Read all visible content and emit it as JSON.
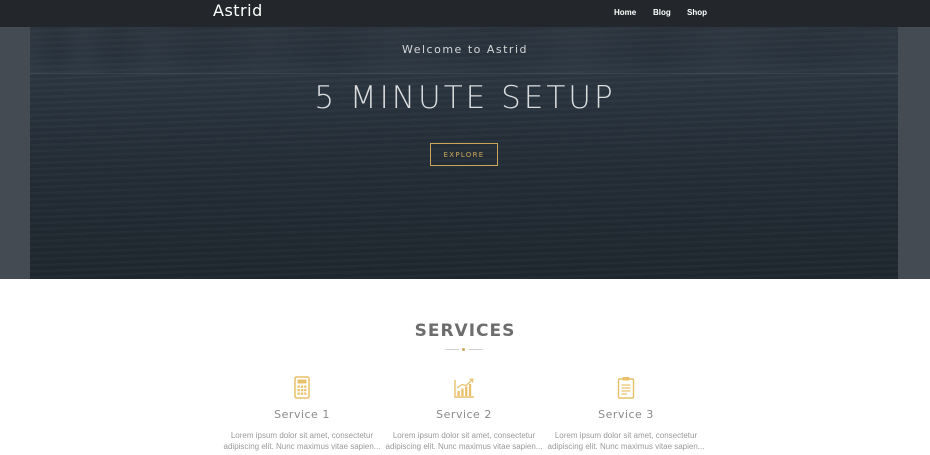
{
  "header": {
    "logo": "Astrid",
    "nav": [
      {
        "label": "Home"
      },
      {
        "label": "Blog"
      },
      {
        "label": "Shop"
      }
    ]
  },
  "hero": {
    "subtitle": "Welcome to Astrid",
    "title": "5 MINUTE SETUP",
    "button_label": "EXPLORE"
  },
  "services": {
    "title": "SERVICES",
    "accent_color": "#c9a65a",
    "items": [
      {
        "icon": "calculator-icon",
        "name": "Service 1",
        "desc_line1": "Lorem ipsum dolor sit amet, consectetur",
        "desc_line2": "adipiscing elit. Nunc maximus vitae sapien..."
      },
      {
        "icon": "chart-icon",
        "name": "Service 2",
        "desc_line1": "Lorem ipsum dolor sit amet, consectetur",
        "desc_line2": "adipiscing elit. Nunc maximus vitae sapien..."
      },
      {
        "icon": "clipboard-icon",
        "name": "Service 3",
        "desc_line1": "Lorem ipsum dolor sit amet, consectetur",
        "desc_line2": "adipiscing elit. Nunc maximus vitae sapien..."
      }
    ]
  }
}
